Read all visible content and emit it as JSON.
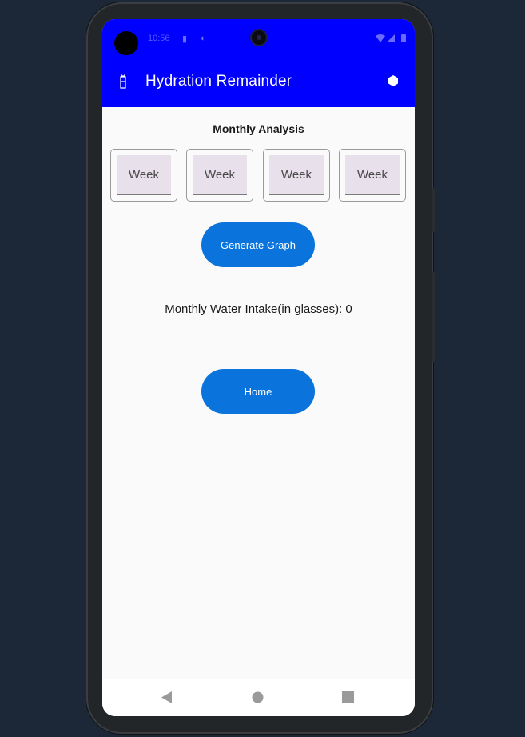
{
  "status_bar": {
    "time": "10:56",
    "icons": [
      "notification-icon",
      "sync-icon",
      "wifi-icon",
      "signal-icon",
      "battery-icon"
    ]
  },
  "app_bar": {
    "title": "Hydration Remainder",
    "app_icon": "water-bottle-icon",
    "action_icon": "hexagon-settings-icon"
  },
  "main": {
    "heading": "Monthly Analysis",
    "week_inputs": [
      {
        "placeholder": "Week"
      },
      {
        "placeholder": "Week"
      },
      {
        "placeholder": "Week"
      },
      {
        "placeholder": "Week"
      }
    ],
    "generate_button": "Generate Graph",
    "intake_text": "Monthly Water Intake(in glasses): 0",
    "home_button": "Home"
  },
  "nav_bar": {
    "back_icon": "back-triangle-icon",
    "home_icon": "home-circle-icon",
    "recents_icon": "recents-square-icon"
  },
  "colors": {
    "app_bar": "#0000ff",
    "button": "#0a74dc",
    "input_fill": "#e8e1ec",
    "background": "#fafafa",
    "page_background": "#1c2738"
  }
}
